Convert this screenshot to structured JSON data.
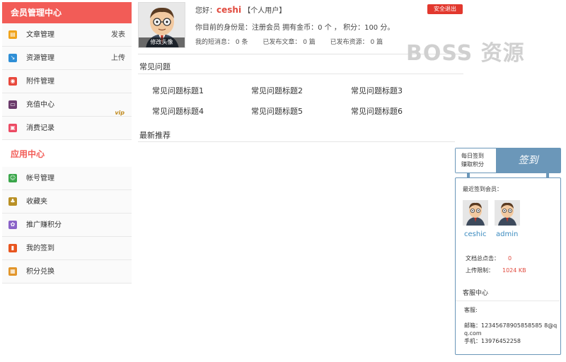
{
  "sidebar": {
    "header": "会员管理中心",
    "items": [
      {
        "label": "文章管理",
        "right": "发表",
        "icon": "document-icon",
        "color": "#f0a31b"
      },
      {
        "label": "资源管理",
        "right": "上传",
        "icon": "resource-icon",
        "color": "#2f8fd6"
      },
      {
        "label": "附件管理",
        "right": "",
        "icon": "bell-icon",
        "color": "#e8483c"
      },
      {
        "label": "充值中心",
        "right": "vip",
        "icon": "card-icon",
        "color": "#6a3a6a"
      },
      {
        "label": "消费记录",
        "right": "",
        "icon": "record-icon",
        "color": "#ec4a63"
      }
    ],
    "app_header": "应用中心",
    "app_items": [
      {
        "label": "帐号管理",
        "icon": "account-icon",
        "color": "#3aa64a"
      },
      {
        "label": "收藏夹",
        "icon": "favorites-icon",
        "color": "#b99025"
      },
      {
        "label": "推广赚积分",
        "icon": "share-icon",
        "color": "#8a63c8"
      },
      {
        "label": "我的签到",
        "icon": "checkin-icon",
        "color": "#e8551f"
      },
      {
        "label": "积分兑换",
        "icon": "exchange-icon",
        "color": "#e2952a"
      }
    ]
  },
  "profile": {
    "avatar_caption": "修改头像",
    "greeting": "您好：",
    "username": "ceshi",
    "user_type": "【个人用户】",
    "logout": "安全退出",
    "identity": "你目前的身份是：注册会员 拥有金币：0 个 ， 积分：100 分。",
    "stats": [
      "我的短消息： 0 条",
      "已发布文章： 0 篇",
      "已发布资源： 0 篇"
    ]
  },
  "watermark": "BOSS 资源",
  "faq": {
    "title": "常见问题",
    "items": [
      "常见问题标题1",
      "常见问题标题2",
      "常见问题标题3",
      "常见问题标题4",
      "常见问题标题5",
      "常见问题标题6"
    ]
  },
  "recommend": {
    "title": "最新推荐"
  },
  "signin": {
    "line1": "每日签到",
    "line2": "赚取积分",
    "button": "签到",
    "recent_label": "最近签到会员：",
    "members": [
      "ceshic",
      "admin"
    ],
    "doc_clicks_label": "文档总点击：",
    "doc_clicks_value": "0",
    "upload_limit_label": "上传限制：",
    "upload_limit_value": "1024 KB",
    "service_title": "客服中心",
    "service_label": "客服:",
    "email": "邮箱：12345678905858585 8@qq.com",
    "phone": "手机：13976452258"
  },
  "colors": {
    "accent": "#f25c57",
    "panel": "#6b97b9",
    "danger": "#e2382e"
  }
}
